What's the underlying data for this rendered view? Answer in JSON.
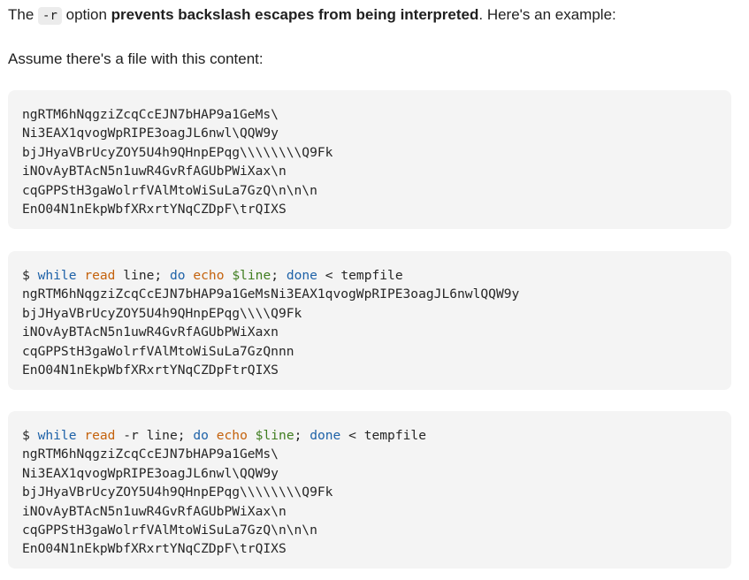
{
  "intro": {
    "before": "The ",
    "code": "-r",
    "middle": " option ",
    "bold": "prevents backslash escapes from being interpreted",
    "after": ". Here's an example:"
  },
  "assume": "Assume there's a file with this content:",
  "file_block": {
    "lines": [
      "ngRTM6hNqgziZcqCcEJN7bHAP9a1GeMs\\",
      "Ni3EAX1qvogWpRIPE3oagJL6nwl\\QQW9y",
      "bjJHyaVBrUcyZOY5U4h9QHnpEPqg\\\\\\\\\\\\\\\\Q9Fk",
      "iNOvAyBTAcN5n1uwR4GvRfAGUbPWiXax\\n",
      "cqGPPStH3gaWolrfVAlMtoWiSuLa7GzQ\\n\\n\\n",
      "EnO04N1nEkpWbfXRxrtYNqCZDpF\\trQIXS"
    ]
  },
  "example_no_r": {
    "cmd": {
      "prompt": "$ ",
      "while": "while",
      "sp1": " ",
      "read": "read",
      "args": " line; ",
      "do": "do",
      "sp2": " ",
      "echo": "echo",
      "sp3": " ",
      "var": "$line",
      "semi": "; ",
      "done": "done",
      "redir": " < tempfile"
    },
    "output": [
      "ngRTM6hNqgziZcqCcEJN7bHAP9a1GeMsNi3EAX1qvogWpRIPE3oagJL6nwlQQW9y",
      "bjJHyaVBrUcyZOY5U4h9QHnpEPqg\\\\\\\\Q9Fk",
      "iNOvAyBTAcN5n1uwR4GvRfAGUbPWiXaxn",
      "cqGPPStH3gaWolrfVAlMtoWiSuLa7GzQnnn",
      "EnO04N1nEkpWbfXRxrtYNqCZDpFtrQIXS"
    ]
  },
  "example_with_r": {
    "cmd": {
      "prompt": "$ ",
      "while": "while",
      "sp1": " ",
      "read": "read",
      "args": " -r line; ",
      "do": "do",
      "sp2": " ",
      "echo": "echo",
      "sp3": " ",
      "var": "$line",
      "semi": "; ",
      "done": "done",
      "redir": " < tempfile"
    },
    "output": [
      "ngRTM6hNqgziZcqCcEJN7bHAP9a1GeMs\\",
      "Ni3EAX1qvogWpRIPE3oagJL6nwl\\QQW9y",
      "bjJHyaVBrUcyZOY5U4h9QHnpEPqg\\\\\\\\\\\\\\\\Q9Fk",
      "iNOvAyBTAcN5n1uwR4GvRfAGUbPWiXax\\n",
      "cqGPPStH3gaWolrfVAlMtoWiSuLa7GzQ\\n\\n\\n",
      "EnO04N1nEkpWbfXRxrtYNqCZDpF\\trQIXS"
    ]
  },
  "colors": {
    "keyword": "#1e62a8",
    "builtin": "#c4620c",
    "variable": "#3f7d1f",
    "code_bg": "#f4f4f4"
  }
}
